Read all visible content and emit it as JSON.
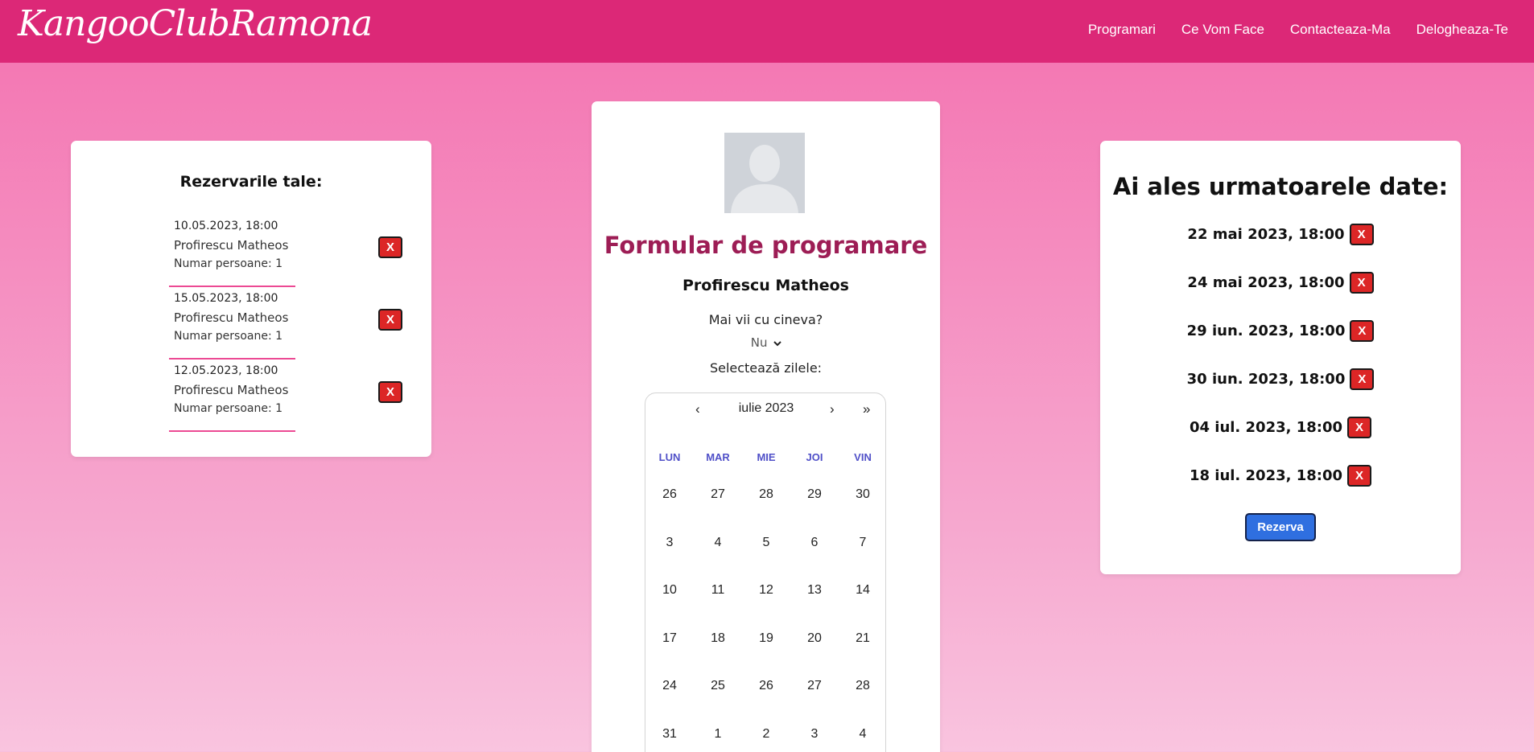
{
  "header": {
    "logo": "KangooClubRamona",
    "nav": [
      "Programari",
      "Ce Vom Face",
      "Contacteaza-Ma",
      "Delogheaza-Te"
    ],
    "bg_color": "#dc2877"
  },
  "reservations": {
    "title": "Rezervarile tale:",
    "items": [
      {
        "date": "10.05.2023, 18:00",
        "name": "Profirescu Matheos",
        "count": "Numar persoane: 1",
        "remove": "X"
      },
      {
        "date": "15.05.2023, 18:00",
        "name": "Profirescu Matheos",
        "count": "Numar persoane: 1",
        "remove": "X"
      },
      {
        "date": "12.05.2023, 18:00",
        "name": "Profirescu Matheos",
        "count": "Numar persoane: 1",
        "remove": "X"
      }
    ]
  },
  "form": {
    "title": "Formular de programare",
    "name": "Profirescu Matheos",
    "question": "Mai vii cu cineva?",
    "select_value": "Nu",
    "days_label": "Selectează zilele:",
    "calendar": {
      "prev": "‹",
      "month": "iulie 2023",
      "next": "›",
      "next_year": "»",
      "weekdays": [
        "LUN",
        "MAR",
        "MIE",
        "JOI",
        "VIN"
      ],
      "weeks": [
        [
          "26",
          "27",
          "28",
          "29",
          "30"
        ],
        [
          "3",
          "4",
          "5",
          "6",
          "7"
        ],
        [
          "10",
          "11",
          "12",
          "13",
          "14"
        ],
        [
          "17",
          "18",
          "19",
          "20",
          "21"
        ],
        [
          "24",
          "25",
          "26",
          "27",
          "28"
        ],
        [
          "31",
          "1",
          "2",
          "3",
          "4"
        ]
      ]
    }
  },
  "selected": {
    "title": "Ai ales urmatoarele date:",
    "dates": [
      "22 mai 2023, 18:00",
      "24 mai 2023, 18:00",
      "29 iun. 2023, 18:00",
      "30 iun. 2023, 18:00",
      "04 iul. 2023, 18:00",
      "18 iul. 2023, 18:00"
    ],
    "remove": "X",
    "submit": "Rezerva"
  }
}
